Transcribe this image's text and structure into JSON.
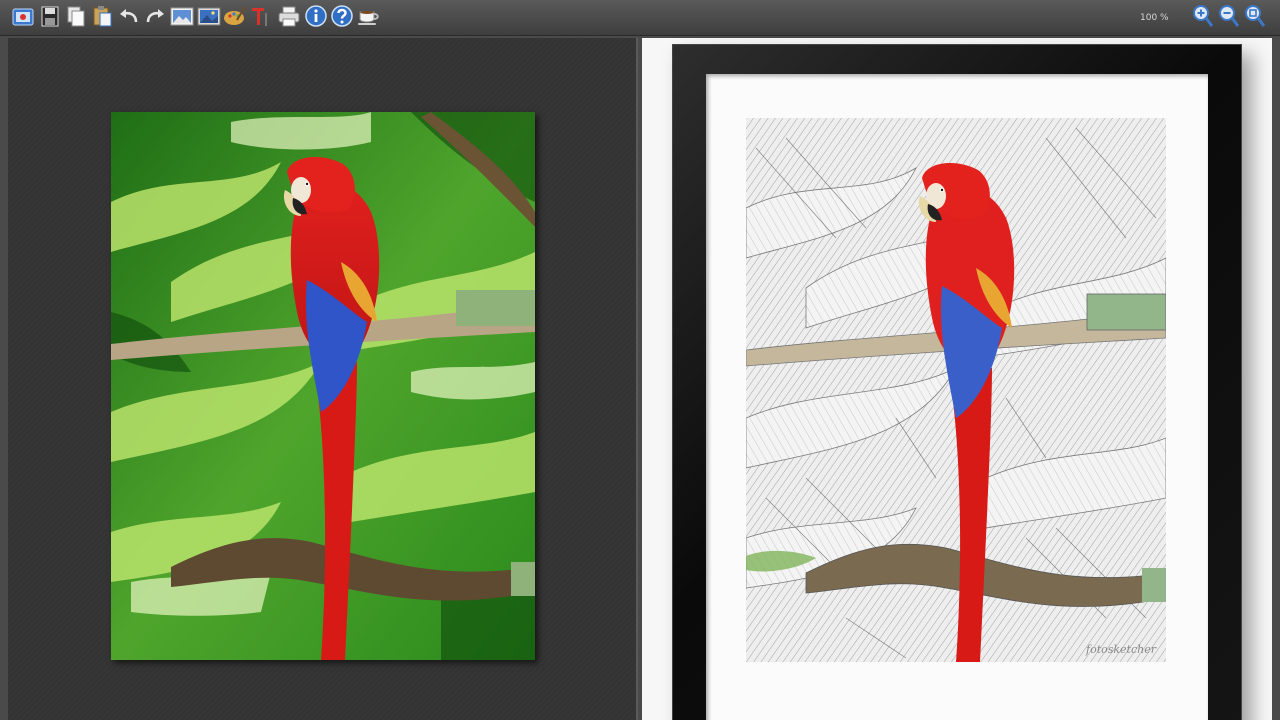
{
  "toolbar": {
    "buttons": [
      {
        "name": "open-button",
        "icon": "open-image-icon"
      },
      {
        "name": "save-button",
        "icon": "save-disk-icon"
      },
      {
        "name": "copy-button",
        "icon": "copy-icon"
      },
      {
        "name": "paste-button",
        "icon": "paste-icon"
      },
      {
        "name": "undo-button",
        "icon": "undo-arrow-icon"
      },
      {
        "name": "redo-button",
        "icon": "redo-arrow-icon"
      },
      {
        "name": "background-button",
        "icon": "landscape-icon"
      },
      {
        "name": "frame-button",
        "icon": "framed-picture-icon"
      },
      {
        "name": "palette-button",
        "icon": "palette-icon"
      },
      {
        "name": "text-button",
        "icon": "text-tool-icon"
      },
      {
        "name": "print-button",
        "icon": "printer-icon"
      },
      {
        "name": "info-button",
        "icon": "info-icon"
      },
      {
        "name": "help-button",
        "icon": "help-icon"
      },
      {
        "name": "donate-button",
        "icon": "coffee-cup-icon"
      }
    ],
    "zoom_label": "100 %",
    "zoom_buttons": [
      "zoom-in-icon",
      "zoom-out-icon",
      "zoom-fit-icon"
    ]
  },
  "left_panel": {
    "image": "original-photo-scarlet-macaw"
  },
  "right_panel": {
    "image": "pencil-sketch-result-framed",
    "signature": "fotosketcher"
  },
  "colors": {
    "toolbar": "#4a4a4a",
    "left_background": "#333333",
    "right_background": "#f7f7f7",
    "frame": "#111111",
    "mat": "#fbfbfb",
    "icon_blue": "#2f6fc4"
  }
}
